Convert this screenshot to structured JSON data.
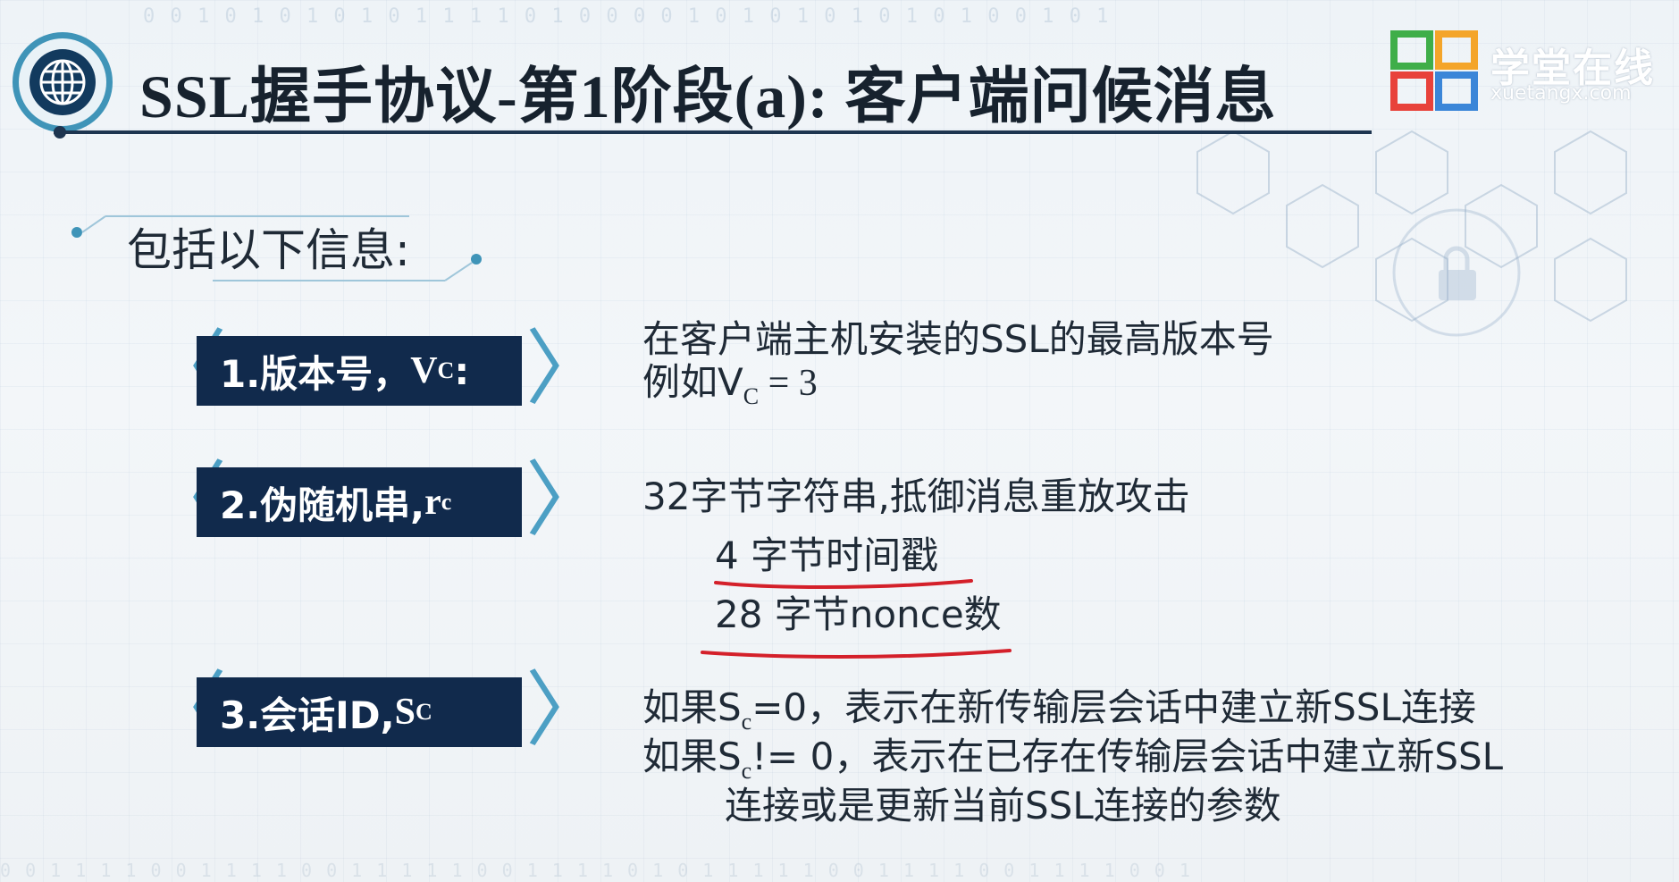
{
  "header": {
    "title": "SSL握手协议-第1阶段(a): 客户端问候消息",
    "logo_text": "学堂在线",
    "logo_url_text": "xuetangx.com"
  },
  "subheading": "包括以下信息:",
  "items": [
    {
      "label_prefix": "1.版本号，",
      "label_var": "V",
      "label_sub": "C",
      "label_suffix": ":",
      "desc_line1": "在客户端主机安装的SSL的最高版本号",
      "desc_line2_prefix": "例如V",
      "desc_line2_sub": "C",
      "desc_line2_suffix": " = 3"
    },
    {
      "label_prefix": "2.伪随机串, ",
      "label_var": "r",
      "label_sub": "c",
      "desc_line1": "32字节字符串,抵御消息重放攻击",
      "desc_line2": "4 字节时间戳",
      "desc_line3": "28 字节nonce数"
    },
    {
      "label_prefix": "3.会话ID, ",
      "label_var": "S",
      "label_sub": "C",
      "desc_line1_prefix": "如果S",
      "desc_line1_sub": "c",
      "desc_line1_suffix": "=0，表示在新传输层会话中建立新SSL连接",
      "desc_line2_prefix": "如果S",
      "desc_line2_sub": "c",
      "desc_line2_suffix": "!= 0，表示在已存在传输层会话中建立新SSL",
      "desc_line3": "连接或是更新当前SSL连接的参数"
    }
  ],
  "colors": {
    "label_bg": "#112a4c",
    "bracket": "#4c9fc4",
    "annotation_red": "#d4202a",
    "accent": "#3f94b8"
  }
}
